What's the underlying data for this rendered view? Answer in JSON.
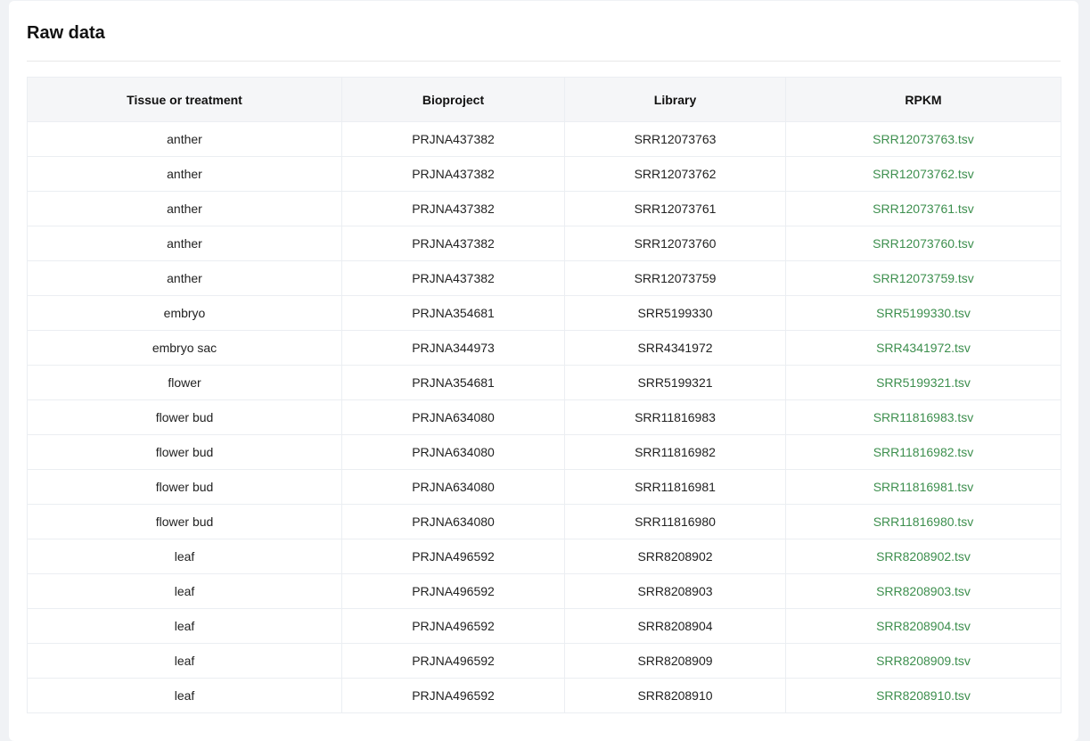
{
  "title": "Raw data",
  "columns": [
    "Tissue or treatment",
    "Bioproject",
    "Library",
    "RPKM"
  ],
  "rows": [
    {
      "tissue": "anther",
      "bioproject": "PRJNA437382",
      "library": "SRR12073763",
      "rpkm": "SRR12073763.tsv"
    },
    {
      "tissue": "anther",
      "bioproject": "PRJNA437382",
      "library": "SRR12073762",
      "rpkm": "SRR12073762.tsv"
    },
    {
      "tissue": "anther",
      "bioproject": "PRJNA437382",
      "library": "SRR12073761",
      "rpkm": "SRR12073761.tsv"
    },
    {
      "tissue": "anther",
      "bioproject": "PRJNA437382",
      "library": "SRR12073760",
      "rpkm": "SRR12073760.tsv"
    },
    {
      "tissue": "anther",
      "bioproject": "PRJNA437382",
      "library": "SRR12073759",
      "rpkm": "SRR12073759.tsv"
    },
    {
      "tissue": "embryo",
      "bioproject": "PRJNA354681",
      "library": "SRR5199330",
      "rpkm": "SRR5199330.tsv"
    },
    {
      "tissue": "embryo sac",
      "bioproject": "PRJNA344973",
      "library": "SRR4341972",
      "rpkm": "SRR4341972.tsv"
    },
    {
      "tissue": "flower",
      "bioproject": "PRJNA354681",
      "library": "SRR5199321",
      "rpkm": "SRR5199321.tsv"
    },
    {
      "tissue": "flower bud",
      "bioproject": "PRJNA634080",
      "library": "SRR11816983",
      "rpkm": "SRR11816983.tsv"
    },
    {
      "tissue": "flower bud",
      "bioproject": "PRJNA634080",
      "library": "SRR11816982",
      "rpkm": "SRR11816982.tsv"
    },
    {
      "tissue": "flower bud",
      "bioproject": "PRJNA634080",
      "library": "SRR11816981",
      "rpkm": "SRR11816981.tsv"
    },
    {
      "tissue": "flower bud",
      "bioproject": "PRJNA634080",
      "library": "SRR11816980",
      "rpkm": "SRR11816980.tsv"
    },
    {
      "tissue": "leaf",
      "bioproject": "PRJNA496592",
      "library": "SRR8208902",
      "rpkm": "SRR8208902.tsv"
    },
    {
      "tissue": "leaf",
      "bioproject": "PRJNA496592",
      "library": "SRR8208903",
      "rpkm": "SRR8208903.tsv"
    },
    {
      "tissue": "leaf",
      "bioproject": "PRJNA496592",
      "library": "SRR8208904",
      "rpkm": "SRR8208904.tsv"
    },
    {
      "tissue": "leaf",
      "bioproject": "PRJNA496592",
      "library": "SRR8208909",
      "rpkm": "SRR8208909.tsv"
    },
    {
      "tissue": "leaf",
      "bioproject": "PRJNA496592",
      "library": "SRR8208910",
      "rpkm": "SRR8208910.tsv"
    }
  ],
  "colors": {
    "link": "#3d8f4e",
    "header_bg": "#f5f6f8",
    "page_bg": "#f0f2f5"
  }
}
